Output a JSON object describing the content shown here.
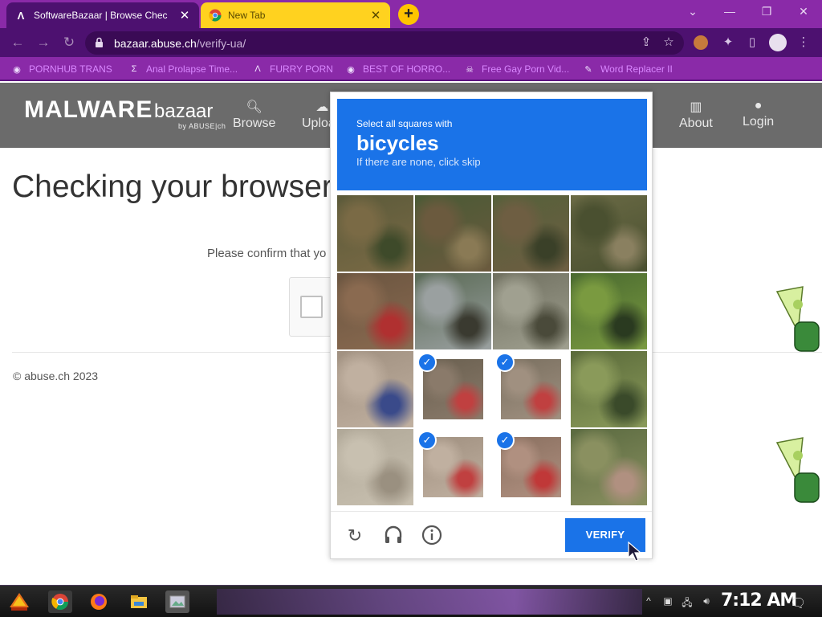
{
  "browser": {
    "tabs": [
      {
        "title": "SoftwareBazaar | Browse Chec",
        "favicon": "abuse-a-icon",
        "active": true
      },
      {
        "title": "New Tab",
        "favicon": "chrome-icon",
        "active": false
      }
    ],
    "new_tab_label": "+",
    "url_host": "bazaar.abuse.ch",
    "url_path": "/verify-ua/",
    "bookmarks": [
      {
        "label": "PORNHUB TRANS",
        "icon": "globe-icon"
      },
      {
        "label": "Anal Prolapse Time...",
        "icon": "sigma-icon"
      },
      {
        "label": "FURRY PORN",
        "icon": "abuse-a-icon"
      },
      {
        "label": "BEST OF HORRO...",
        "icon": "globe-icon"
      },
      {
        "label": "Free Gay Porn Vid...",
        "icon": "skull-icon"
      },
      {
        "label": "Word Replacer II",
        "icon": "wr-icon"
      }
    ]
  },
  "site": {
    "logo_main": "MALWARE",
    "logo_sub": "bazaar",
    "logo_by": "by ABUSE|ch",
    "nav": [
      {
        "label": "Browse",
        "icon": "search-icon"
      },
      {
        "label": "Upload",
        "icon": "upload-icon"
      },
      {
        "label": "About",
        "icon": "building-icon"
      },
      {
        "label": "Login",
        "icon": "user-icon"
      }
    ],
    "heading": "Checking your browser",
    "confirm_text": "Please confirm that yo",
    "footer": "© abuse.ch 2023"
  },
  "captcha": {
    "line1": "Select all squares with",
    "target": "bicycles",
    "hint": "If there are none, click skip",
    "selected_cells": [
      9,
      10,
      13,
      14
    ],
    "verify_label": "VERIFY"
  },
  "taskbar": {
    "clock": "7:12 AM"
  },
  "colors": {
    "tabstrip": "#8a2aa8",
    "toolbar": "#4d1170",
    "captcha_blue": "#1a73e8",
    "site_nav": "#6b6b6b"
  }
}
